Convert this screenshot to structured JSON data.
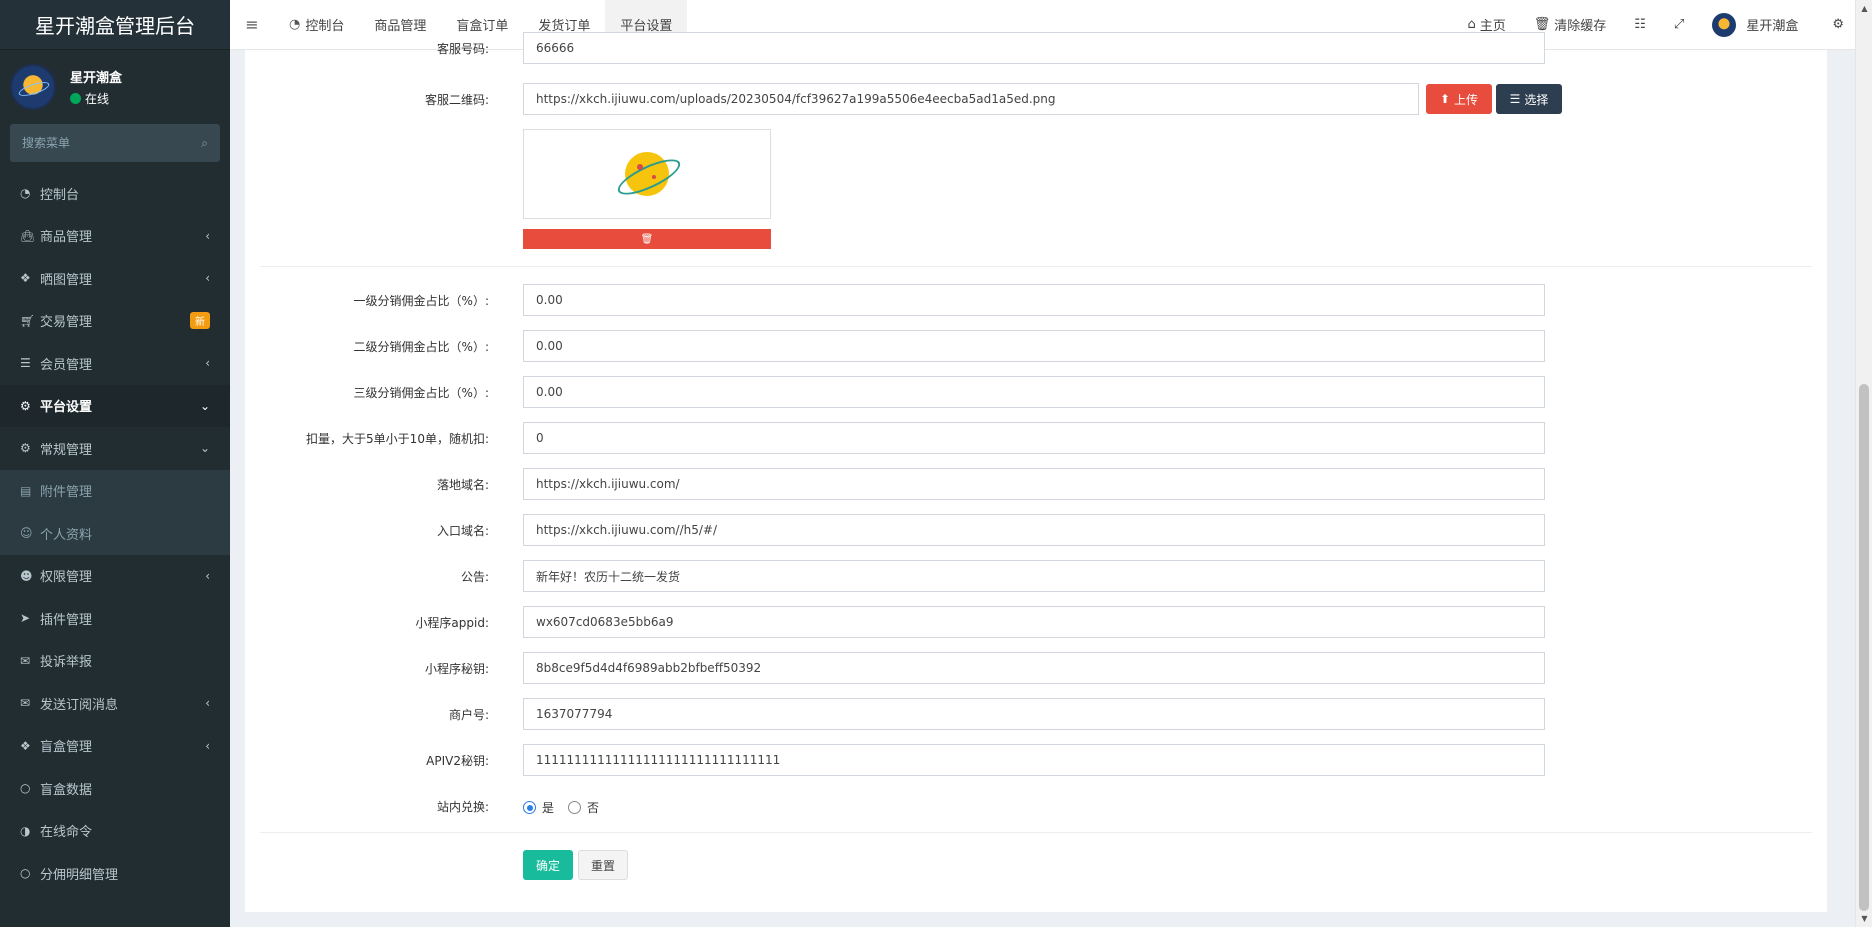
{
  "app": {
    "title": "星开潮盒管理后台"
  },
  "user": {
    "name": "星开潮盒",
    "status": "在线"
  },
  "search": {
    "placeholder": "搜索菜单"
  },
  "sidebar": {
    "items": [
      {
        "label": "控制台",
        "icon": "dashboard-icon"
      },
      {
        "label": "商品管理",
        "icon": "shopping-bag-icon",
        "arrow": "‹"
      },
      {
        "label": "晒图管理",
        "icon": "dropbox-icon",
        "arrow": "‹"
      },
      {
        "label": "交易管理",
        "icon": "cart-icon",
        "badge": "新"
      },
      {
        "label": "会员管理",
        "icon": "list-icon",
        "arrow": "‹"
      },
      {
        "label": "平台设置",
        "icon": "cogs-icon",
        "arrow": "⌄"
      },
      {
        "label": "常规管理",
        "icon": "cogs-icon",
        "arrow": "⌄"
      },
      {
        "label": "附件管理",
        "icon": "file-image-icon"
      },
      {
        "label": "个人资料",
        "icon": "user-icon"
      },
      {
        "label": "权限管理",
        "icon": "group-icon",
        "arrow": "‹"
      },
      {
        "label": "插件管理",
        "icon": "rocket-icon"
      },
      {
        "label": "投诉举报",
        "icon": "envelope-icon"
      },
      {
        "label": "发送订阅消息",
        "icon": "envelope-icon",
        "arrow": "‹"
      },
      {
        "label": "盲盒管理",
        "icon": "dropbox-icon",
        "arrow": "‹"
      },
      {
        "label": "盲盒数据",
        "icon": "circle-icon"
      },
      {
        "label": "在线命令",
        "icon": "adjust-icon"
      },
      {
        "label": "分佣明细管理",
        "icon": "circle-icon"
      }
    ]
  },
  "navbar": {
    "tabs": [
      {
        "label": "控制台",
        "icon": "dashboard-icon"
      },
      {
        "label": "商品管理"
      },
      {
        "label": "盲盒订单"
      },
      {
        "label": "发货订单"
      },
      {
        "label": "平台设置"
      }
    ],
    "home": "主页",
    "clear_cache": "清除缓存",
    "username": "星开潮盒"
  },
  "form": {
    "top_partial": {
      "label": "客服号码:",
      "value": "66666"
    },
    "qrcode": {
      "label": "客服二维码:",
      "value": "https://xkch.ijiuwu.com/uploads/20230504/fcf39627a199a5506e4eecba5ad1a5ed.png"
    },
    "upload_label": "上传",
    "select_label": "选择",
    "fields": [
      {
        "label": "一级分销佣金占比（%）:",
        "value": "0.00"
      },
      {
        "label": "二级分销佣金占比（%）:",
        "value": "0.00"
      },
      {
        "label": "三级分销佣金占比（%）:",
        "value": "0.00"
      },
      {
        "label": "扣量，大于5单小于10单，随机扣:",
        "value": "0"
      },
      {
        "label": "落地域名:",
        "value": "https://xkch.ijiuwu.com/"
      },
      {
        "label": "入口域名:",
        "value": "https://xkch.ijiuwu.com//h5/#/"
      },
      {
        "label": "公告:",
        "value": "新年好！农历十二统一发货"
      },
      {
        "label": "小程序appid:",
        "value": "wx607cd0683e5bb6a9"
      },
      {
        "label": "小程序秘钥:",
        "value": "8b8ce9f5d4d4f6989abb2bfbeff50392"
      },
      {
        "label": "商户号:",
        "value": "1637077794"
      },
      {
        "label": "APIV2秘钥:",
        "value": "11111111111111111111111111111111"
      }
    ],
    "exchange": {
      "label": "站内兑换:",
      "yes": "是",
      "no": "否",
      "selected": "yes"
    },
    "submit_label": "确定",
    "reset_label": "重置"
  }
}
